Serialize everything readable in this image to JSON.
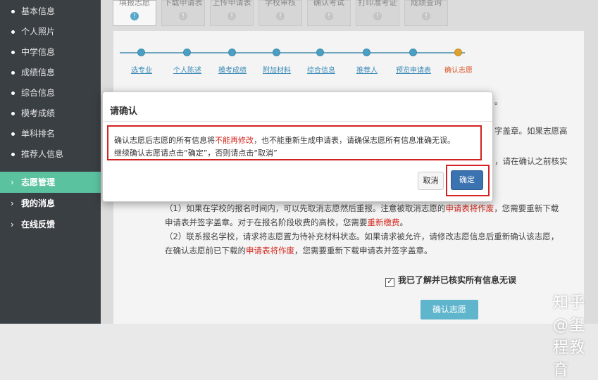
{
  "sidebar": {
    "items": [
      "基本信息",
      "个人照片",
      "中学信息",
      "成绩信息",
      "综合信息",
      "模考成绩",
      "单科排名",
      "推荐人信息"
    ],
    "main": [
      {
        "label": "志愿管理",
        "icon": "chevron-right-icon",
        "glyph": "›"
      },
      {
        "label": "我的消息",
        "icon": "chevron-right-icon",
        "glyph": "›"
      },
      {
        "label": "在线反馈",
        "icon": "chevron-right-icon",
        "glyph": "›"
      }
    ]
  },
  "tabs": [
    {
      "label": "填报志愿",
      "glyph": "!"
    },
    {
      "label": "下载申请表",
      "glyph": "!"
    },
    {
      "label": "上传申请表",
      "glyph": "!"
    },
    {
      "label": "学校审核",
      "glyph": "!"
    },
    {
      "label": "确认考试",
      "glyph": "!"
    },
    {
      "label": "打印准考证",
      "glyph": "!"
    },
    {
      "label": "成绩查询",
      "glyph": "!"
    }
  ],
  "steps": [
    "选专业",
    "个人陈述",
    "模考成绩",
    "附加材料",
    "综合信息",
    "推荐人",
    "预览申请表",
    "确认志愿"
  ],
  "background": {
    "frag1": "。",
    "frag2": "字盖章。如果志愿高",
    "frag3": "，请在确认之前核实",
    "para1_a": "（1）如果在学校的报名时间内，可以先取消志愿然后重报。注意被取消志愿的",
    "para1_red": "申请表将作废",
    "para1_b": "，您需要重新下载",
    "para1_c": "申请表并签字盖章。对于在报名阶段收费的高校，您需要",
    "para1_red2": "重新缴费",
    "para1_d": "。",
    "para2_a": "（2）联系报名学校，请求将志愿置为待补充材料状态。如果请求被允许，请修改志愿信息后重新确认该志愿，",
    "para2_b": "在确认志愿前已下载的",
    "para2_red": "申请表将作废",
    "para2_c": "，您需要重新下载申请表并签字盖章。"
  },
  "agree_label": "我已了解并已核实所有信息无误",
  "agree_check": "✓",
  "confirm_button": "确认志愿",
  "watermark": "知乎 @玺程教育",
  "modal": {
    "title": "请确认",
    "line1_a": "确认志愿后志愿的所有信息将",
    "line1_red": "不能再修改",
    "line1_b": "，也不能重新生成申请表，请确保志愿所有信息准确无误。",
    "line2": "继续确认志愿请点击“确定”，否则请点击“取消”",
    "cancel": "取消",
    "ok": "确定"
  },
  "colors": {
    "sidebar_bg": "#3a3f44",
    "active": "#5bc2a0",
    "step": "#4a9fc2",
    "current_step": "#e0a030",
    "highlight_red": "#d22222",
    "ok_button": "#3b72b0"
  }
}
